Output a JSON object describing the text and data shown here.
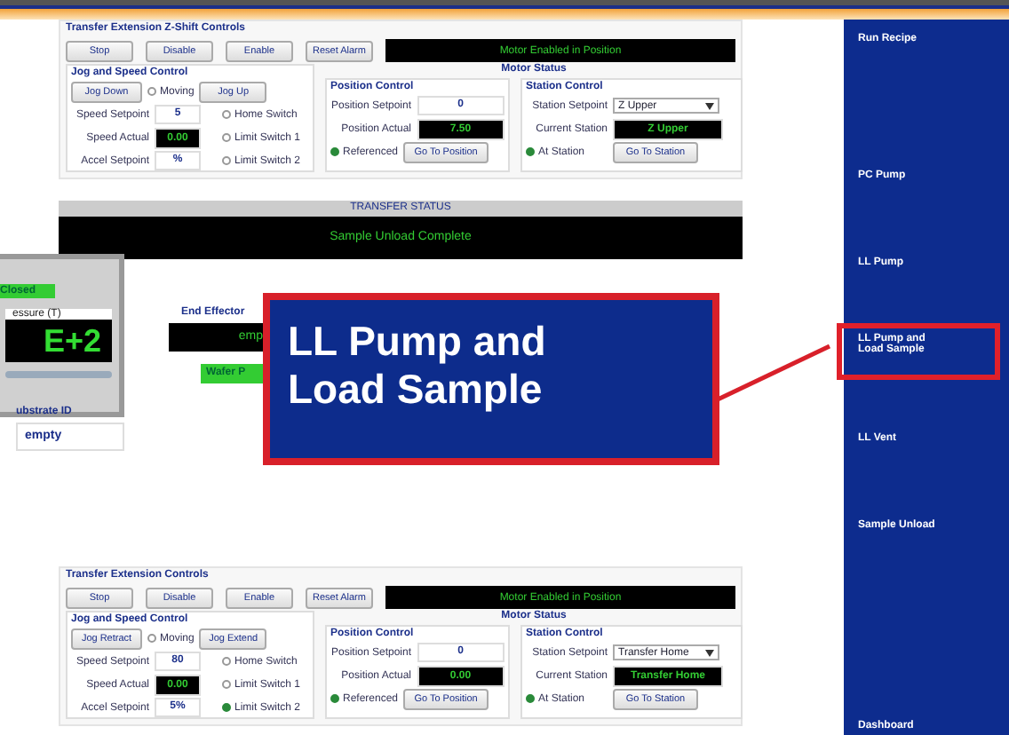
{
  "panels": [
    {
      "title": "Transfer Extension Z-Shift Controls",
      "buttons": [
        "Stop",
        "Disable",
        "Enable",
        "Reset Alarm"
      ],
      "status": "Motor Enabled in Position",
      "motor_status_label": "Motor Status",
      "jog": {
        "title": "Jog and Speed Control",
        "buttons": [
          "Jog Down",
          "Jog Up"
        ],
        "moving": {
          "label": "Moving",
          "on": false
        },
        "fields": [
          {
            "label": "Speed Setpoint",
            "value": "5",
            "kind": "input"
          },
          {
            "label": "Speed Actual",
            "value": "0.00",
            "kind": "display"
          },
          {
            "label": "Accel Setpoint",
            "value": "%",
            "kind": "input"
          }
        ],
        "switches": [
          {
            "label": "Home Switch",
            "on": false
          },
          {
            "label": "Limit Switch 1",
            "on": false
          },
          {
            "label": "Limit Switch 2",
            "on": false
          }
        ]
      },
      "position": {
        "title": "Position Control",
        "setpoint_label": "Position Setpoint",
        "setpoint": "0",
        "actual_label": "Position Actual",
        "actual": "7.50",
        "referenced": {
          "label": "Referenced",
          "on": true
        },
        "button": "Go To Position"
      },
      "station": {
        "title": "Station Control",
        "setpoint_label": "Station Setpoint",
        "setpoint": "Z Upper",
        "current_label": "Current Station",
        "current": "Z Upper",
        "at_station": {
          "label": "At Station",
          "on": true
        },
        "button": "Go To Station"
      }
    },
    {
      "title": "Transfer Extension Controls",
      "buttons": [
        "Stop",
        "Disable",
        "Enable",
        "Reset Alarm"
      ],
      "status": "Motor Enabled in Position",
      "motor_status_label": "Motor Status",
      "jog": {
        "title": "Jog and Speed Control",
        "buttons": [
          "Jog Retract",
          "Jog Extend"
        ],
        "moving": {
          "label": "Moving",
          "on": false
        },
        "fields": [
          {
            "label": "Speed Setpoint",
            "value": "80",
            "kind": "input"
          },
          {
            "label": "Speed Actual",
            "value": "0.00",
            "kind": "display"
          },
          {
            "label": "Accel Setpoint",
            "value": "5%",
            "kind": "input"
          }
        ],
        "switches": [
          {
            "label": "Home Switch",
            "on": false
          },
          {
            "label": "Limit Switch 1",
            "on": false
          },
          {
            "label": "Limit Switch 2",
            "on": true
          }
        ]
      },
      "position": {
        "title": "Position Control",
        "setpoint_label": "Position Setpoint",
        "setpoint": "0",
        "actual_label": "Position Actual",
        "actual": "0.00",
        "referenced": {
          "label": "Referenced",
          "on": true
        },
        "button": "Go To Position"
      },
      "station": {
        "title": "Station Control",
        "setpoint_label": "Station Setpoint",
        "setpoint": "Transfer Home",
        "current_label": "Current Station",
        "current": "Transfer Home",
        "at_station": {
          "label": "At Station",
          "on": true
        },
        "button": "Go To Station"
      }
    }
  ],
  "transfer_status": {
    "title": "TRANSFER STATUS",
    "message": "Sample Unload Complete"
  },
  "chamber_window": {
    "valve": "Closed",
    "pressure_label": "essure (T)",
    "pressure": "E+2"
  },
  "substrate": {
    "label": "ubstrate ID",
    "value": "empty"
  },
  "end_effector": {
    "label": "End Effector",
    "value": "emp",
    "button": "Wafer P"
  },
  "callout": {
    "text": "LL Pump and Load Sample"
  },
  "sidebar": {
    "items": [
      {
        "label": "Run Recipe",
        "highlighted": false
      },
      {
        "label": "PC Pump",
        "highlighted": false
      },
      {
        "label": "LL Pump",
        "highlighted": false
      },
      {
        "label": "LL Pump and Load Sample",
        "highlighted": true
      },
      {
        "label": "LL Vent",
        "highlighted": false
      },
      {
        "label": "Sample Unload",
        "highlighted": false
      },
      {
        "label": "Dashboard",
        "highlighted": false
      }
    ]
  }
}
